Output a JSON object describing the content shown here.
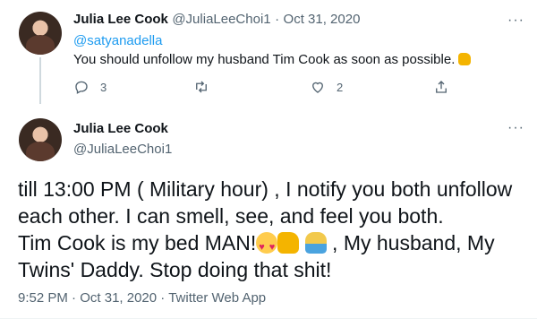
{
  "parent_tweet": {
    "name": "Julia Lee Cook",
    "handle": "@JuliaLeeChoi1",
    "separator": "·",
    "date": "Oct 31, 2020",
    "reply_to": "@satyanadella",
    "text": "You should unfollow my husband Tim Cook as soon as possible.",
    "actions": {
      "reply_count": "3",
      "retweet_count": "",
      "like_count": "2"
    }
  },
  "main_tweet": {
    "name": "Julia Lee Cook",
    "handle": "@JuliaLeeChoi1",
    "lines": [
      "till 13:00 PM ( Military hour) , I notify you both unfollow",
      "each other. I can smell, see, and feel you both.",
      "Tim Cook is my bed MAN!",
      ", My husband, My",
      "Twins' Daddy. Stop doing that shit!"
    ],
    "time": "9:52 PM",
    "separator": "·",
    "date": "Oct 31, 2020",
    "separator2": "·",
    "source": "Twitter Web App"
  },
  "icons": {
    "more": "more-icon",
    "reply": "reply-icon",
    "retweet": "retweet-icon",
    "like": "heart-icon",
    "share": "share-icon"
  },
  "colors": {
    "link": "#1d9bf0",
    "muted": "#536471",
    "text": "#0f1419",
    "thread_line": "#cfd9de"
  }
}
